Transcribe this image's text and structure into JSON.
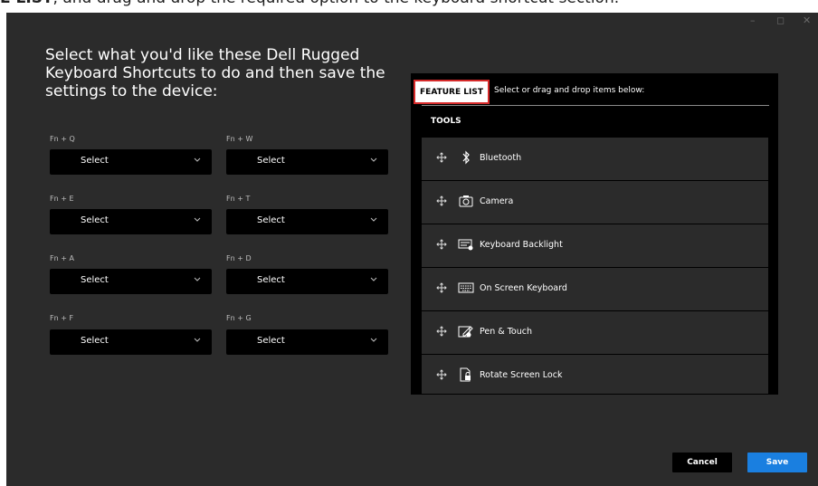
{
  "caption": {
    "bold_part": "E LIST",
    "rest": ", and drag and drop the required option to the keyboard shortcut section."
  },
  "instructions": "Select what you'd like these Dell Rugged Keyboard Shortcuts to do and then save the settings to the device:",
  "shortcuts": [
    {
      "key": "Fn + Q",
      "value": "Select"
    },
    {
      "key": "Fn + W",
      "value": "Select"
    },
    {
      "key": "Fn + E",
      "value": "Select"
    },
    {
      "key": "Fn + T",
      "value": "Select"
    },
    {
      "key": "Fn + A",
      "value": "Select"
    },
    {
      "key": "Fn + D",
      "value": "Select"
    },
    {
      "key": "Fn + F",
      "value": "Select"
    },
    {
      "key": "Fn + G",
      "value": "Select"
    }
  ],
  "feature_panel": {
    "label": "FEATURE LIST",
    "hint": "Select or drag and drop items below:",
    "section": "TOOLS",
    "items": [
      {
        "label": "Bluetooth",
        "icon": "bluetooth-icon"
      },
      {
        "label": "Camera",
        "icon": "camera-icon"
      },
      {
        "label": "Keyboard Backlight",
        "icon": "keyboard-backlight-icon"
      },
      {
        "label": "On Screen Keyboard",
        "icon": "keyboard-icon"
      },
      {
        "label": "Pen & Touch",
        "icon": "pen-touch-icon"
      },
      {
        "label": "Rotate Screen Lock",
        "icon": "rotate-lock-icon"
      }
    ]
  },
  "buttons": {
    "cancel": "Cancel",
    "save": "Save"
  },
  "colors": {
    "background": "#2b2b2b",
    "panel": "#000000",
    "accent": "#1a7fe0",
    "highlight": "#d62a2a"
  }
}
